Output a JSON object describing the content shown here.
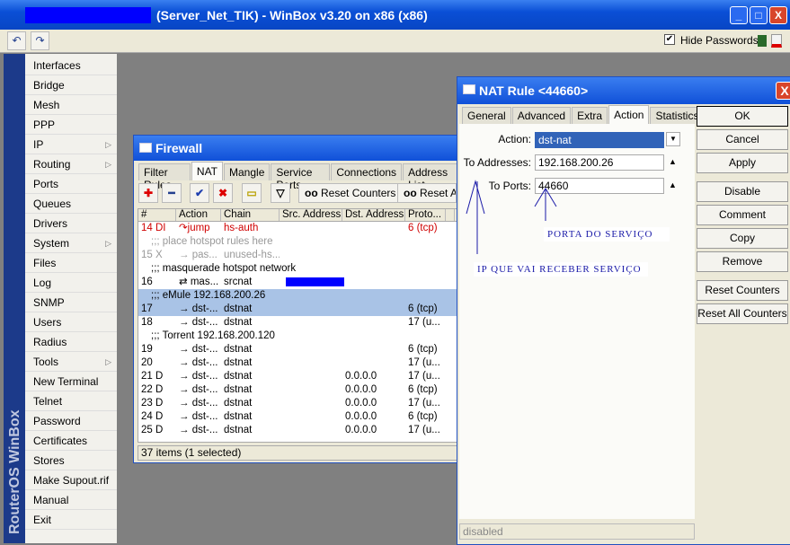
{
  "window": {
    "title": "(Server_Net_TIK) - WinBox v3.20 on x86 (x86)",
    "hide_passwords": "Hide Passwords",
    "minimize": "_",
    "maximize": "□",
    "close": "X"
  },
  "toolbar": {
    "undo": "↶",
    "redo": "↷",
    "check": "✔"
  },
  "sidebar": {
    "brand": "RouterOS WinBox",
    "items": [
      {
        "label": "Interfaces"
      },
      {
        "label": "Bridge"
      },
      {
        "label": "Mesh"
      },
      {
        "label": "PPP"
      },
      {
        "label": "IP",
        "sub": true
      },
      {
        "label": "Routing",
        "sub": true
      },
      {
        "label": "Ports"
      },
      {
        "label": "Queues"
      },
      {
        "label": "Drivers"
      },
      {
        "label": "System",
        "sub": true
      },
      {
        "label": "Files"
      },
      {
        "label": "Log"
      },
      {
        "label": "SNMP"
      },
      {
        "label": "Users"
      },
      {
        "label": "Radius"
      },
      {
        "label": "Tools",
        "sub": true
      },
      {
        "label": "New Terminal"
      },
      {
        "label": "Telnet"
      },
      {
        "label": "Password"
      },
      {
        "label": "Certificates"
      },
      {
        "label": "Stores"
      },
      {
        "label": "Make Supout.rif"
      },
      {
        "label": "Manual"
      },
      {
        "label": "Exit"
      }
    ],
    "arrow": "▷"
  },
  "firewall": {
    "title": "Firewall",
    "tabs": [
      "Filter Rules",
      "NAT",
      "Mangle",
      "Service Ports",
      "Connections",
      "Address List"
    ],
    "tools": {
      "add": "✚",
      "remove": "━",
      "enable": "✔",
      "disable": "✖",
      "comment": "▭",
      "filter": "▽",
      "reset_counters": "Reset Counters",
      "reset_all": "Reset All Counters",
      "oo": "oo"
    },
    "columns": [
      "#",
      "",
      "Action",
      "Chain",
      "Src. Address",
      "Dst. Address",
      "Proto...",
      ""
    ],
    "rows": [
      {
        "num": "14",
        "flag": "DI",
        "action": "jump",
        "chain": "hs-auth",
        "src": "",
        "dst": "",
        "proto": "6 (tcp)",
        "style": "red"
      },
      {
        "comment": ";;; place hotspot rules here",
        "style": "grey"
      },
      {
        "num": "15",
        "flag": "X",
        "action": "pas...",
        "chain": "unused-hs...",
        "src": "",
        "dst": "",
        "proto": "",
        "style": "grey"
      },
      {
        "comment": ";;; masquerade hotspot network"
      },
      {
        "num": "16",
        "flag": "",
        "action": "mas...",
        "chain": "srcnat",
        "src": "",
        "dst": "",
        "proto": "",
        "redacted": true
      },
      {
        "comment": ";;; eMule 192.168.200.26",
        "style": "sel"
      },
      {
        "num": "17",
        "flag": "",
        "action": "dst-...",
        "chain": "dstnat",
        "src": "",
        "dst": "",
        "proto": "6 (tcp)",
        "style": "sel"
      },
      {
        "num": "18",
        "flag": "",
        "action": "dst-...",
        "chain": "dstnat",
        "src": "",
        "dst": "",
        "proto": "17 (u..."
      },
      {
        "comment": ";;; Torrent 192.168.200.120"
      },
      {
        "num": "19",
        "flag": "",
        "action": "dst-...",
        "chain": "dstnat",
        "src": "",
        "dst": "",
        "proto": "6 (tcp)"
      },
      {
        "num": "20",
        "flag": "",
        "action": "dst-...",
        "chain": "dstnat",
        "src": "",
        "dst": "",
        "proto": "17 (u..."
      },
      {
        "num": "21",
        "flag": "D",
        "action": "dst-...",
        "chain": "dstnat",
        "src": "",
        "dst": "0.0.0.0",
        "proto": "17 (u..."
      },
      {
        "num": "22",
        "flag": "D",
        "action": "dst-...",
        "chain": "dstnat",
        "src": "",
        "dst": "0.0.0.0",
        "proto": "6 (tcp)"
      },
      {
        "num": "23",
        "flag": "D",
        "action": "dst-...",
        "chain": "dstnat",
        "src": "",
        "dst": "0.0.0.0",
        "proto": "17 (u..."
      },
      {
        "num": "24",
        "flag": "D",
        "action": "dst-...",
        "chain": "dstnat",
        "src": "",
        "dst": "0.0.0.0",
        "proto": "6 (tcp)"
      },
      {
        "num": "25",
        "flag": "D",
        "action": "dst-...",
        "chain": "dstnat",
        "src": "",
        "dst": "0.0.0.0",
        "proto": "17 (u..."
      }
    ],
    "status": "37 items (1 selected)"
  },
  "nat_rule": {
    "title": "NAT Rule <44660>",
    "tabs": [
      "General",
      "Advanced",
      "Extra",
      "Action",
      "Statistics"
    ],
    "action_label": "Action:",
    "action_value": "dst-nat",
    "to_addresses_label": "To Addresses:",
    "to_addresses": "192.168.200.26",
    "to_ports_label": "To Ports:",
    "to_ports": "44660",
    "buttons": [
      "OK",
      "Cancel",
      "Apply",
      "Disable",
      "Comment",
      "Copy",
      "Remove",
      "Reset Counters",
      "Reset All Counters"
    ],
    "status": "disabled",
    "close": "X",
    "dropdown": "▼",
    "up": "▲",
    "note_port": "PORTA DO SERVIÇO",
    "note_ip": "IP QUE VAI RECEBER SERVIÇO"
  }
}
